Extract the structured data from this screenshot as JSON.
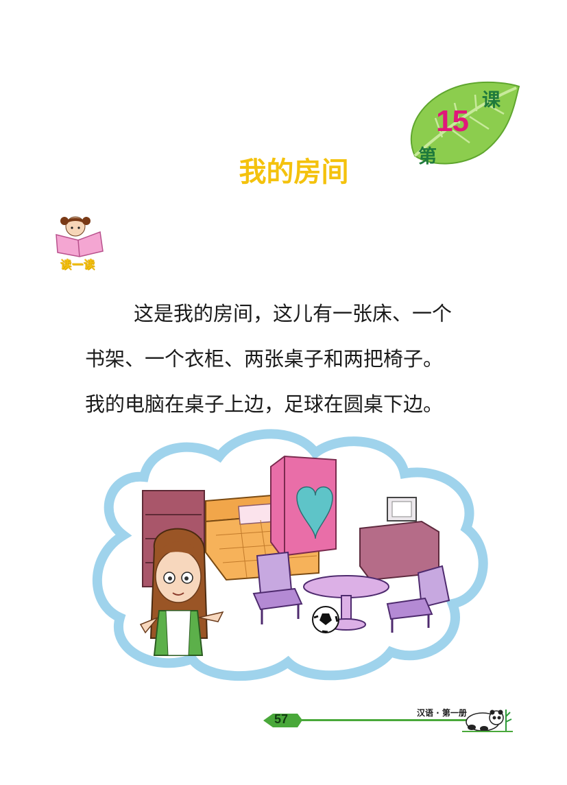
{
  "lesson": {
    "prefix": "第",
    "number": "15",
    "suffix": "课"
  },
  "title": "我的房间",
  "section_label": "读一读",
  "passage": {
    "lines": [
      "这是我的房间，这儿有一张床、一个",
      "书架、一个衣柜、两张桌子和两把椅子。",
      "我的电脑在桌子上边，足球在圆桌下边。"
    ]
  },
  "footer": {
    "page_number": "57",
    "book_title": "汉语 · 第一册"
  },
  "colors": {
    "title": "#f4c20d",
    "leaf": "#7cc142",
    "lesson_number": "#e0187a",
    "lesson_chars": "#1f7a3c",
    "footer_bar": "#49a83a"
  }
}
